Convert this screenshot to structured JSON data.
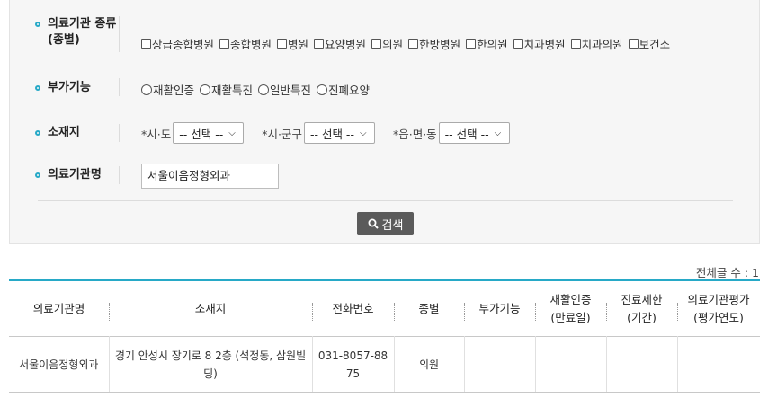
{
  "filters": {
    "type": {
      "label_line1": "의료기관 종류",
      "label_line2": "(종별)",
      "options": [
        "상급종합병원",
        "종합병원",
        "병원",
        "요양병원",
        "의원",
        "한방병원",
        "한의원",
        "치과병원",
        "치과의원",
        "보건소"
      ]
    },
    "extra": {
      "label": "부가기능",
      "options": [
        "재활인증",
        "재활특진",
        "일반특진",
        "진폐요양"
      ]
    },
    "location": {
      "label": "소재지",
      "sido_label": "*시·도",
      "sigungu_label": "*시·군구",
      "eupmyeondong_label": "*읍·면·동",
      "select_default": "-- 선택 --"
    },
    "name": {
      "label": "의료기관명",
      "value": "서울이음정형외과"
    },
    "search_button": "검색"
  },
  "results": {
    "total_label": "전체글 수 : 1",
    "headers": [
      {
        "line1": "의료기관명",
        "line2": ""
      },
      {
        "line1": "소재지",
        "line2": ""
      },
      {
        "line1": "전화번호",
        "line2": ""
      },
      {
        "line1": "종별",
        "line2": ""
      },
      {
        "line1": "부가기능",
        "line2": ""
      },
      {
        "line1": "재활인증",
        "line2": "(만료일)"
      },
      {
        "line1": "진료제한",
        "line2": "(기간)"
      },
      {
        "line1": "의료기관평가",
        "line2": "(평가연도)"
      }
    ],
    "rows": [
      {
        "name": "서울이음정형외과",
        "address": "경기 안성시 장기로 8 2층 (석정동, 삼원빌딩)",
        "phone": "031-8057-8875",
        "type": "의원",
        "extra": "",
        "rehab": "",
        "restriction": "",
        "evaluation": ""
      }
    ]
  },
  "colors": {
    "accent": "#27a9c7",
    "button": "#5b5b5b",
    "panel": "#f6f6f6"
  }
}
